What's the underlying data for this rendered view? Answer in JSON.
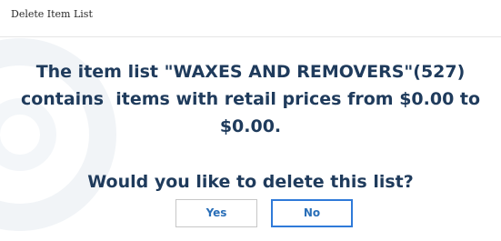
{
  "window": {
    "title": "Delete Item List"
  },
  "message": {
    "line1": "The item list \"WAXES AND REMOVERS\"(527)",
    "line2": "contains  items with retail prices from $0.00 to",
    "line3": "$0.00."
  },
  "question": "Would you like to delete this list?",
  "buttons": {
    "yes": "Yes",
    "no": "No"
  },
  "colors": {
    "message_text": "#1f3b5c",
    "button_text": "#2a6fb8",
    "focused_border": "#2f7ad9"
  }
}
